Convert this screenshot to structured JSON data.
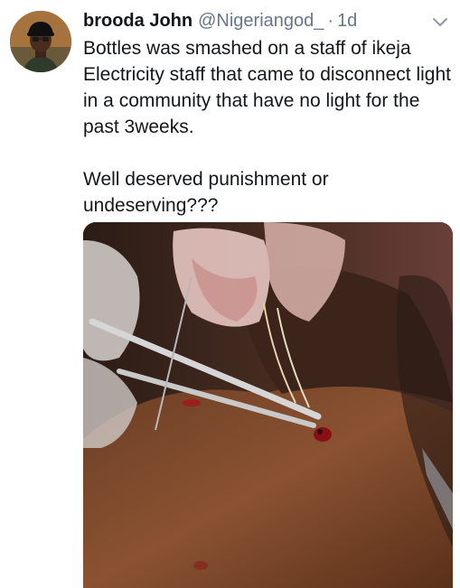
{
  "tweet": {
    "display_name": "brooda John",
    "handle": "@Nigeriangod_",
    "separator": "·",
    "time": "1d",
    "text_paragraphs": [
      "Bottles was smashed on a staff of ikeja Electricity staff that came to disconnect light in a community that have no light for the past 3weeks.",
      "Well deserved punishment or undeserving???"
    ],
    "media_description_icon": "photo-wound-treatment"
  },
  "icons": {
    "avatar": "avatar-icon",
    "menu": "chevron-down-icon"
  },
  "colors": {
    "text_primary": "#14171a",
    "text_secondary": "#657786"
  }
}
